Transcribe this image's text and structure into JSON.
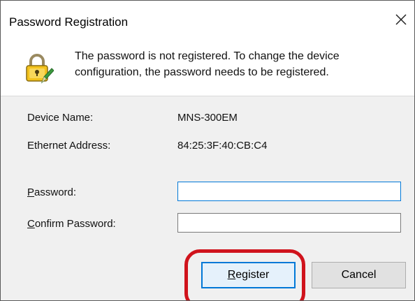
{
  "window": {
    "title": "Password Registration"
  },
  "message": {
    "line1": "The password is not registered. To change the device",
    "line2": "configuration, the password needs to be registered."
  },
  "device": {
    "name_label": "Device Name:",
    "name_value": "MNS-300EM",
    "ethernet_label": "Ethernet Address:",
    "ethernet_value": "84:25:3F:40:CB:C4"
  },
  "form": {
    "password_label_accel": "P",
    "password_label_rest": "assword:",
    "password_value": "",
    "confirm_label_accel": "C",
    "confirm_label_rest": "onfirm Password:",
    "confirm_value": ""
  },
  "buttons": {
    "register_accel": "R",
    "register_rest": "egister",
    "cancel": "Cancel"
  },
  "colors": {
    "highlight": "#d0131c",
    "focus": "#0078d7"
  },
  "icons": {
    "header": "lock-pencil-icon",
    "close": "close-icon"
  }
}
